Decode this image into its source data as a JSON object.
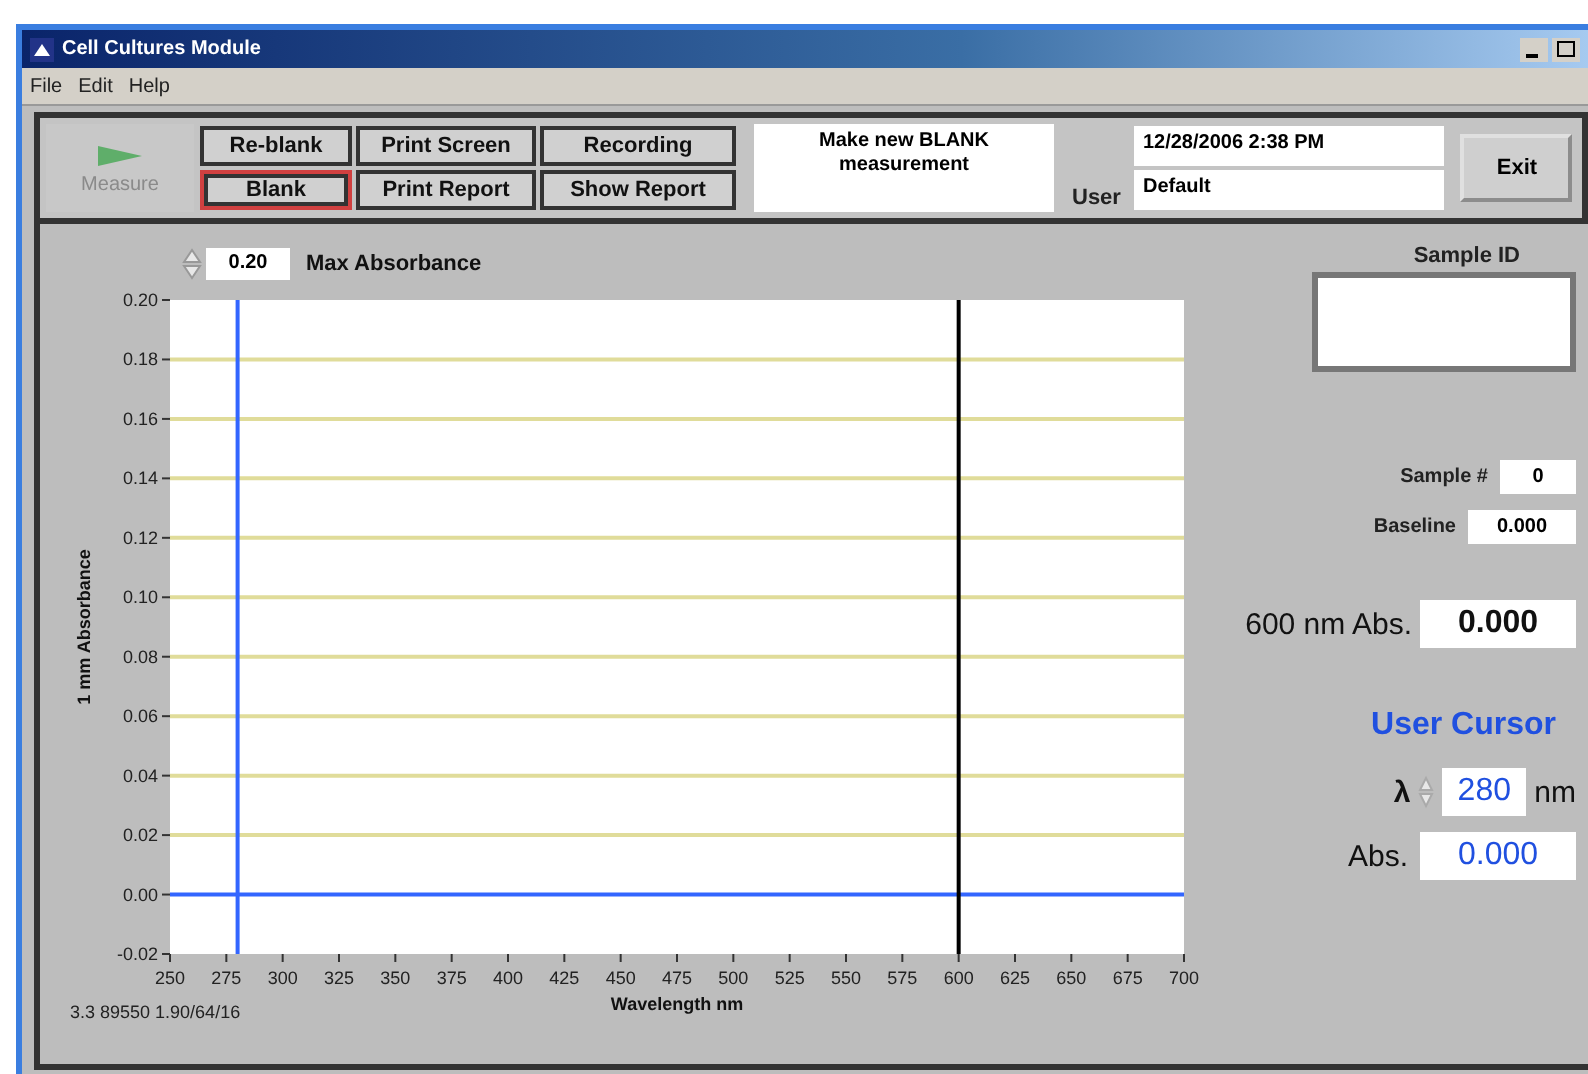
{
  "window": {
    "title": "Cell Cultures Module"
  },
  "menu": [
    "File",
    "Edit",
    "Help"
  ],
  "toolbar": {
    "measure": {
      "label": "Measure",
      "disabled": true
    },
    "buttons": [
      {
        "label": "Re-blank",
        "highlighted": false
      },
      {
        "label": "Print Screen",
        "highlighted": false
      },
      {
        "label": "Recording",
        "highlighted": false
      },
      {
        "label": "Blank",
        "highlighted": true
      },
      {
        "label": "Print Report",
        "highlighted": false
      },
      {
        "label": "Show Report",
        "highlighted": false
      }
    ],
    "message": "Make new BLANK measurement",
    "datetime": "12/28/2006  2:38 PM",
    "user_label": "User",
    "user": "Default",
    "exit": "Exit"
  },
  "max_absorbance": {
    "value": "0.20",
    "label": "Max Absorbance"
  },
  "chart_data": {
    "type": "line",
    "xlabel": "Wavelength nm",
    "ylabel": "1 mm Absorbance",
    "x": [
      250,
      700
    ],
    "series": [
      {
        "color": "#3366ff",
        "values": [
          0,
          0
        ]
      }
    ],
    "grid": true,
    "xlim": [
      250,
      700
    ],
    "ylim": [
      -0.02,
      0.2
    ],
    "xticks": [
      250,
      275,
      300,
      325,
      350,
      375,
      400,
      425,
      450,
      475,
      500,
      525,
      550,
      575,
      600,
      625,
      650,
      675,
      700
    ],
    "yticks": [
      {
        "value": -0.02,
        "label": "-0.02"
      },
      {
        "value": 0,
        "label": "0.00"
      },
      {
        "value": 0.02,
        "label": "0.02"
      },
      {
        "value": 0.04,
        "label": "0.04"
      },
      {
        "value": 0.06,
        "label": "0.06"
      },
      {
        "value": 0.08,
        "label": "0.08"
      },
      {
        "value": 0.1,
        "label": "0.10"
      },
      {
        "value": 0.12,
        "label": "0.12"
      },
      {
        "value": 0.14,
        "label": "0.14"
      },
      {
        "value": 0.16,
        "label": "0.16"
      },
      {
        "value": 0.18,
        "label": "0.18"
      },
      {
        "value": 0.2,
        "label": "0.20"
      }
    ],
    "ref_lines": [
      {
        "axis": "x",
        "value": 280,
        "color": "#3366ff"
      },
      {
        "axis": "x",
        "value": 600,
        "color": "#000000"
      }
    ]
  },
  "version": "3.3 89550 1.90/64/16",
  "side": {
    "sample_id_label": "Sample ID",
    "sample_no_label": "Sample #",
    "sample_no": "0",
    "baseline_label": "Baseline",
    "baseline": "0.000",
    "abs600_label": "600 nm Abs.",
    "abs600": "0.000",
    "cursor_title": "User Cursor",
    "lambda_label": "λ",
    "lambda": "280",
    "lambda_unit": "nm",
    "abs_label": "Abs.",
    "abs": "0.000"
  }
}
